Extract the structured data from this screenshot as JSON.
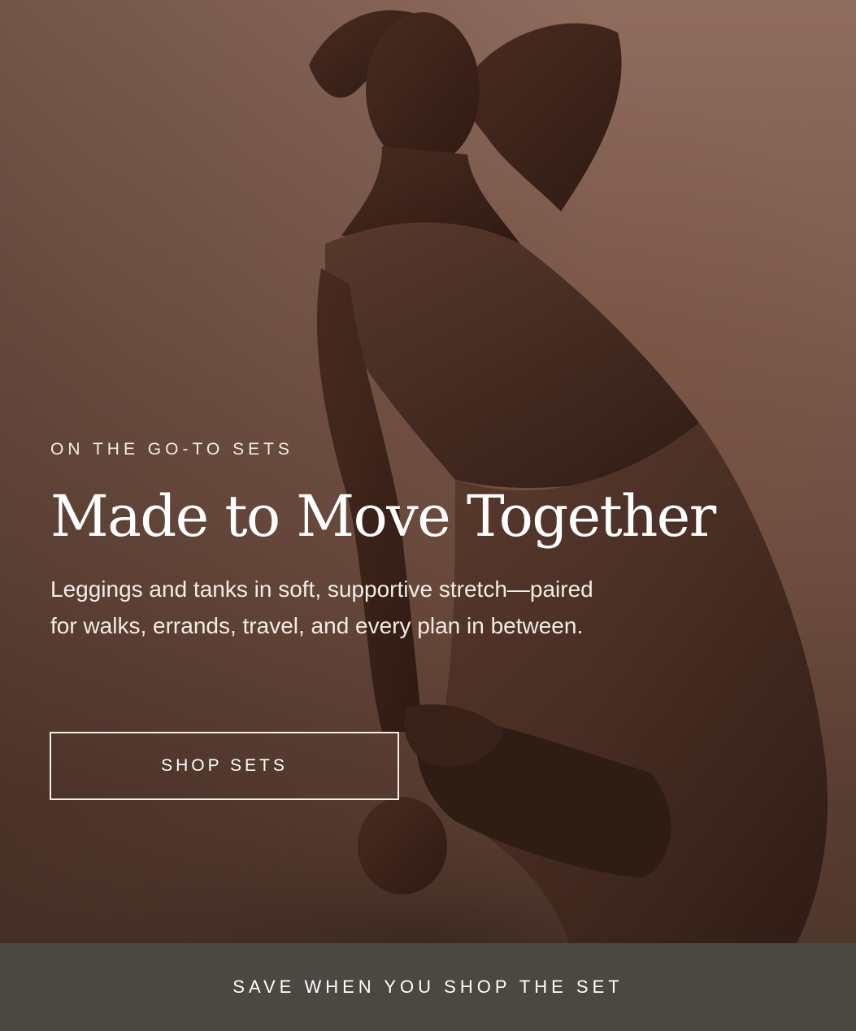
{
  "hero": {
    "image_alt": "Model kneeling in a brown tank and leggings set",
    "eyebrow": "ON THE GO-TO SETS",
    "headline": "Made to Move Together",
    "body": "Leggings and tanks in soft, supportive stretch—paired for walks, errands, travel, and every plan in between.",
    "cta_label": "SHOP SETS"
  },
  "footer": {
    "label": "SAVE WHEN YOU SHOP THE SET"
  },
  "colors": {
    "background_brown": "#7c5a4c",
    "outfit_brown": "#5a3a2d",
    "footer_bar": "#4a4841",
    "text": "#ffffff"
  }
}
